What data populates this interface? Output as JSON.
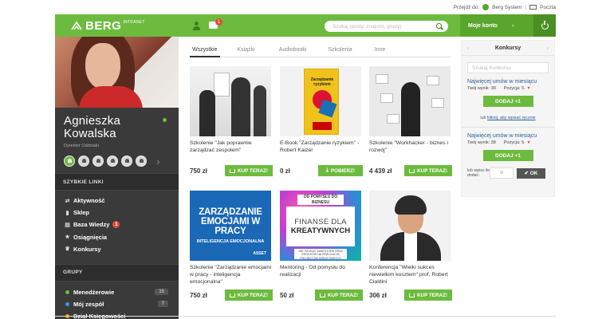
{
  "topbar": {
    "prefix": "Przejdź do:",
    "system_link": "Berg System",
    "mail_link": "Poczta"
  },
  "brand": {
    "name": "BERG",
    "sub": "INTRANET"
  },
  "profile": {
    "first_name": "Agnieszka",
    "last_name": "Kowalska",
    "role": "Dyrektor Oddziału"
  },
  "sidebar": {
    "quick_links_title": "SZYBKIE LINKI",
    "quick_links": [
      {
        "label": "Aktywność",
        "icon": "activity-icon"
      },
      {
        "label": "Sklep",
        "icon": "shop-icon"
      },
      {
        "label": "Baza Wiedzy",
        "icon": "book-icon",
        "count": "1"
      },
      {
        "label": "Osiągnięcia",
        "icon": "star-icon"
      },
      {
        "label": "Konkursy",
        "icon": "trophy-icon"
      }
    ],
    "groups_title": "GRUPY",
    "groups": [
      {
        "label": "Menedżerowie",
        "count": "15",
        "color": "#6dbb3e"
      },
      {
        "label": "Mój zespół",
        "count": "7",
        "color": "#3498db"
      },
      {
        "label": "Dział Księgowości",
        "count": "",
        "color": "#f39c12"
      }
    ]
  },
  "header": {
    "message_count": "1",
    "search_placeholder": "Szukaj (posty, znajomi, grupy)"
  },
  "account": {
    "label": "Moje konto",
    "chevron": "›"
  },
  "tabs": [
    {
      "label": "Wszystkie",
      "active": true
    },
    {
      "label": "Książki",
      "active": false
    },
    {
      "label": "Audiobooki",
      "active": false
    },
    {
      "label": "Szkolenia",
      "active": false
    },
    {
      "label": "Inne",
      "active": false
    }
  ],
  "products": [
    {
      "title": "Szkolenie \"Jak poprawnie zarządzać zespołem\"",
      "price": "750 zł",
      "button": "KUP TERAZ!"
    },
    {
      "title": "E-Book \"Zarządzanie ryzykiem\" - Robert Kaizer",
      "price": "0 zł",
      "button": "POBIERZ!"
    },
    {
      "title": "Szkolenie \"Workhacker - biznes i rozwój\"",
      "price": "4 439 zł",
      "button": "KUP TERAZ!"
    },
    {
      "title": "Szkolenie \"Zarządzanie emocjami w pracy - inteligencja emocjonalna\"",
      "price": "750 zł",
      "button": "KUP TERAZ!"
    },
    {
      "title": "Mentoring - Od pomysłu do realizacji",
      "price": "50 zł",
      "button": "KUP TERAZ!"
    },
    {
      "title": "Konferencja \"Wielki sukces niewielkim kosztem\" prof. Robert Cialdini",
      "price": "306 zł",
      "button": "KUP TERAZ!"
    }
  ],
  "covers": {
    "ebook_title": "Zarządzanie ryzykiem",
    "asset_title": "ZARZĄDZANIE EMOCJAMI W PRACY",
    "asset_sub": "INTELIGENCJA EMOCJONALNA",
    "asset_brand": "ASSET",
    "fin_top": "OD POMYSŁU DO BIZNESU",
    "fin_line1": "FINANSE DLA",
    "fin_line2": "KREATYWNYCH",
    "fin_sub": "JAK SZUKAĆ INWESTORA ORAZ ŚRODKÓW NA REALIZACJĘ PROJEKTÓW KREATYWNYCH"
  },
  "contests": {
    "title": "Konkursy",
    "search_placeholder": "Szukaj Konkursu",
    "items": [
      {
        "title": "Najwięcej umów w miesiącu",
        "score": "Twój wynik: 38",
        "position": "Pozycja: 5.",
        "trend": "▼",
        "button": "DODAJ +1",
        "alt_prefix": "lub",
        "alt_link": "kliknij, aby wpisać ręcznie"
      },
      {
        "title": "Najwięcej umów w miesiącu",
        "score": "Twój wynik: 38",
        "position": "Pozycja: 5.",
        "trend": "▼",
        "button": "DODAJ +1",
        "entry_label": "lub wpisz ile dodać:",
        "entry_value": "0",
        "ok_button": "✔ OK"
      }
    ]
  }
}
